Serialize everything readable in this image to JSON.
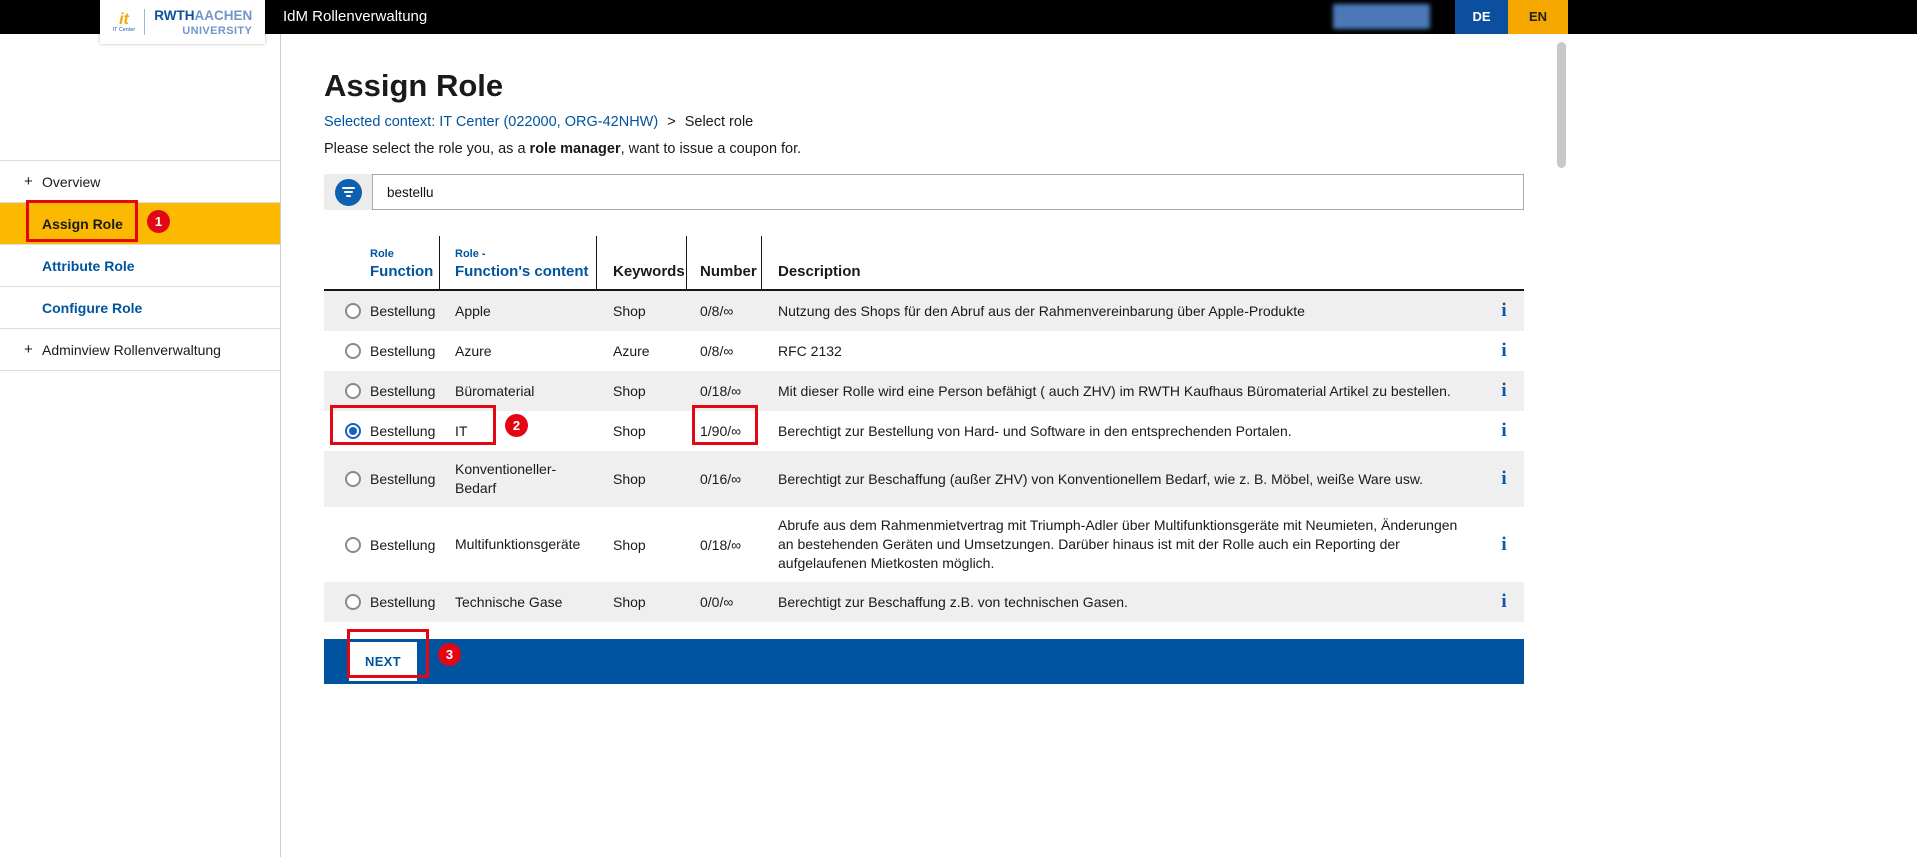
{
  "topbar": {
    "app_title": "IdM Rollenverwaltung",
    "lang_de": "DE",
    "lang_en": "EN",
    "logo": {
      "it_mark": "it",
      "it_caption": "IT Center",
      "rwth": "RWTH",
      "aachen": "AACHEN",
      "university": "UNIVERSITY"
    }
  },
  "sidebar": {
    "items": [
      {
        "prefix": "+",
        "label": "Overview"
      },
      {
        "prefix": "",
        "label": "Assign Role"
      },
      {
        "prefix": "",
        "label": "Attribute Role"
      },
      {
        "prefix": "",
        "label": "Configure Role"
      },
      {
        "prefix": "+",
        "label": "Adminview Rollenverwaltung"
      }
    ]
  },
  "main": {
    "title": "Assign Role",
    "breadcrumb": {
      "link": "Selected context: IT Center (022000, ORG-42NHW)",
      "separator": ">",
      "current": "Select role"
    },
    "instruction": {
      "pre": "Please select the role you, as a ",
      "bold": "role manager",
      "post": ", want to issue a coupon for."
    },
    "search": {
      "value": "bestellu"
    }
  },
  "table": {
    "headers": {
      "col1_top": "Role",
      "col1_main": "Function",
      "col2_top": "Role -",
      "col2_main": "Function's content",
      "col3": "Keywords",
      "col4": "Number",
      "col5": "Description"
    },
    "selected_row_index": 3,
    "rows": [
      {
        "function": "Bestellung",
        "content": "Apple",
        "keywords": "Shop",
        "number": "0/8/∞",
        "description": "Nutzung des Shops für den Abruf aus der Rahmenvereinbarung über Apple-Produkte"
      },
      {
        "function": "Bestellung",
        "content": "Azure",
        "keywords": "Azure",
        "number": "0/8/∞",
        "description": "RFC 2132"
      },
      {
        "function": "Bestellung",
        "content": "Büromaterial",
        "keywords": "Shop",
        "number": "0/18/∞",
        "description": "Mit dieser Rolle wird eine Person befähigt ( auch ZHV) im RWTH Kaufhaus Büromaterial Artikel zu bestellen."
      },
      {
        "function": "Bestellung",
        "content": "IT",
        "keywords": "Shop",
        "number": "1/90/∞",
        "description": "Berechtigt zur Bestellung von Hard- und Software in den entsprechenden Portalen."
      },
      {
        "function": "Bestellung",
        "content": "Konventioneller-Bedarf",
        "keywords": "Shop",
        "number": "0/16/∞",
        "description": "Berechtigt zur Beschaffung (außer ZHV) von Konventionellem Bedarf, wie z. B. Möbel, weiße Ware usw."
      },
      {
        "function": "Bestellung",
        "content": "Multifunktionsgeräte",
        "keywords": "Shop",
        "number": "0/18/∞",
        "description": "Abrufe aus dem Rahmenmietvertrag mit Triumph-Adler über Multifunktionsgeräte mit Neumieten, Änderungen an bestehenden Geräten und Umsetzungen. Darüber hinaus ist mit der Rolle auch ein Reporting der aufgelaufenen Mietkosten möglich."
      },
      {
        "function": "Bestellung",
        "content": "Technische Gase",
        "keywords": "Shop",
        "number": "0/0/∞",
        "description": "Berechtigt zur Beschaffung z.B. von technischen Gasen."
      }
    ]
  },
  "footer": {
    "next_label": "NEXT"
  },
  "annotations": {
    "step1": "1",
    "step2": "2",
    "step3": "3"
  },
  "icons": {
    "info_glyph": "i"
  },
  "colors": {
    "brand_blue": "#00549f",
    "brand_yellow": "#fbba00",
    "annotation_red": "#e30613"
  }
}
